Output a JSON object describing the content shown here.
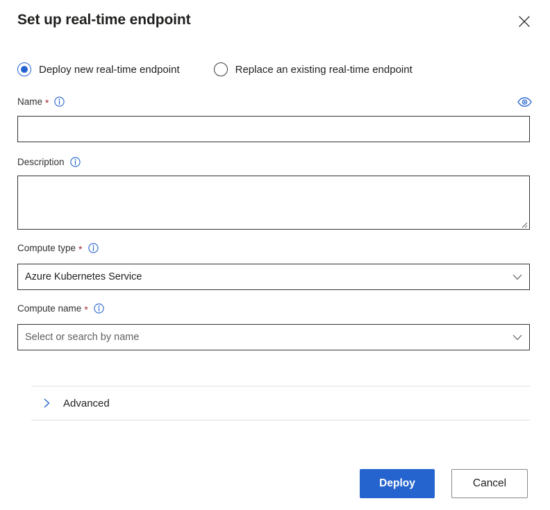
{
  "dialog": {
    "title": "Set up real-time endpoint",
    "close_icon": "close-icon"
  },
  "deploy_mode": {
    "selected": "deploy_new",
    "options": [
      {
        "id": "deploy_new",
        "label": "Deploy new real-time endpoint",
        "checked": true
      },
      {
        "id": "replace_existing",
        "label": "Replace an existing real-time endpoint",
        "checked": false
      }
    ]
  },
  "fields": {
    "name": {
      "label": "Name",
      "required_marker": "*",
      "info_icon": "info-icon",
      "value": "",
      "placeholder": "",
      "visibility_toggle_icon": "eye-icon"
    },
    "description": {
      "label": "Description",
      "info_icon": "info-icon",
      "value": "",
      "placeholder": ""
    },
    "compute_type": {
      "label": "Compute type",
      "required_marker": "*",
      "info_icon": "info-icon",
      "value": "Azure Kubernetes Service",
      "chevron_icon": "chevron-down-icon"
    },
    "compute_name": {
      "label": "Compute name",
      "required_marker": "*",
      "info_icon": "info-icon",
      "value": "",
      "placeholder": "Select or search by name",
      "chevron_icon": "chevron-down-icon"
    }
  },
  "advanced": {
    "label": "Advanced",
    "expanded": false,
    "chevron_icon": "chevron-right-icon"
  },
  "footer": {
    "primary_label": "Deploy",
    "secondary_label": "Cancel"
  },
  "colors": {
    "accent": "#2564cf",
    "required": "#a4262c",
    "border": "#323130",
    "divider": "#e1dfdd"
  }
}
